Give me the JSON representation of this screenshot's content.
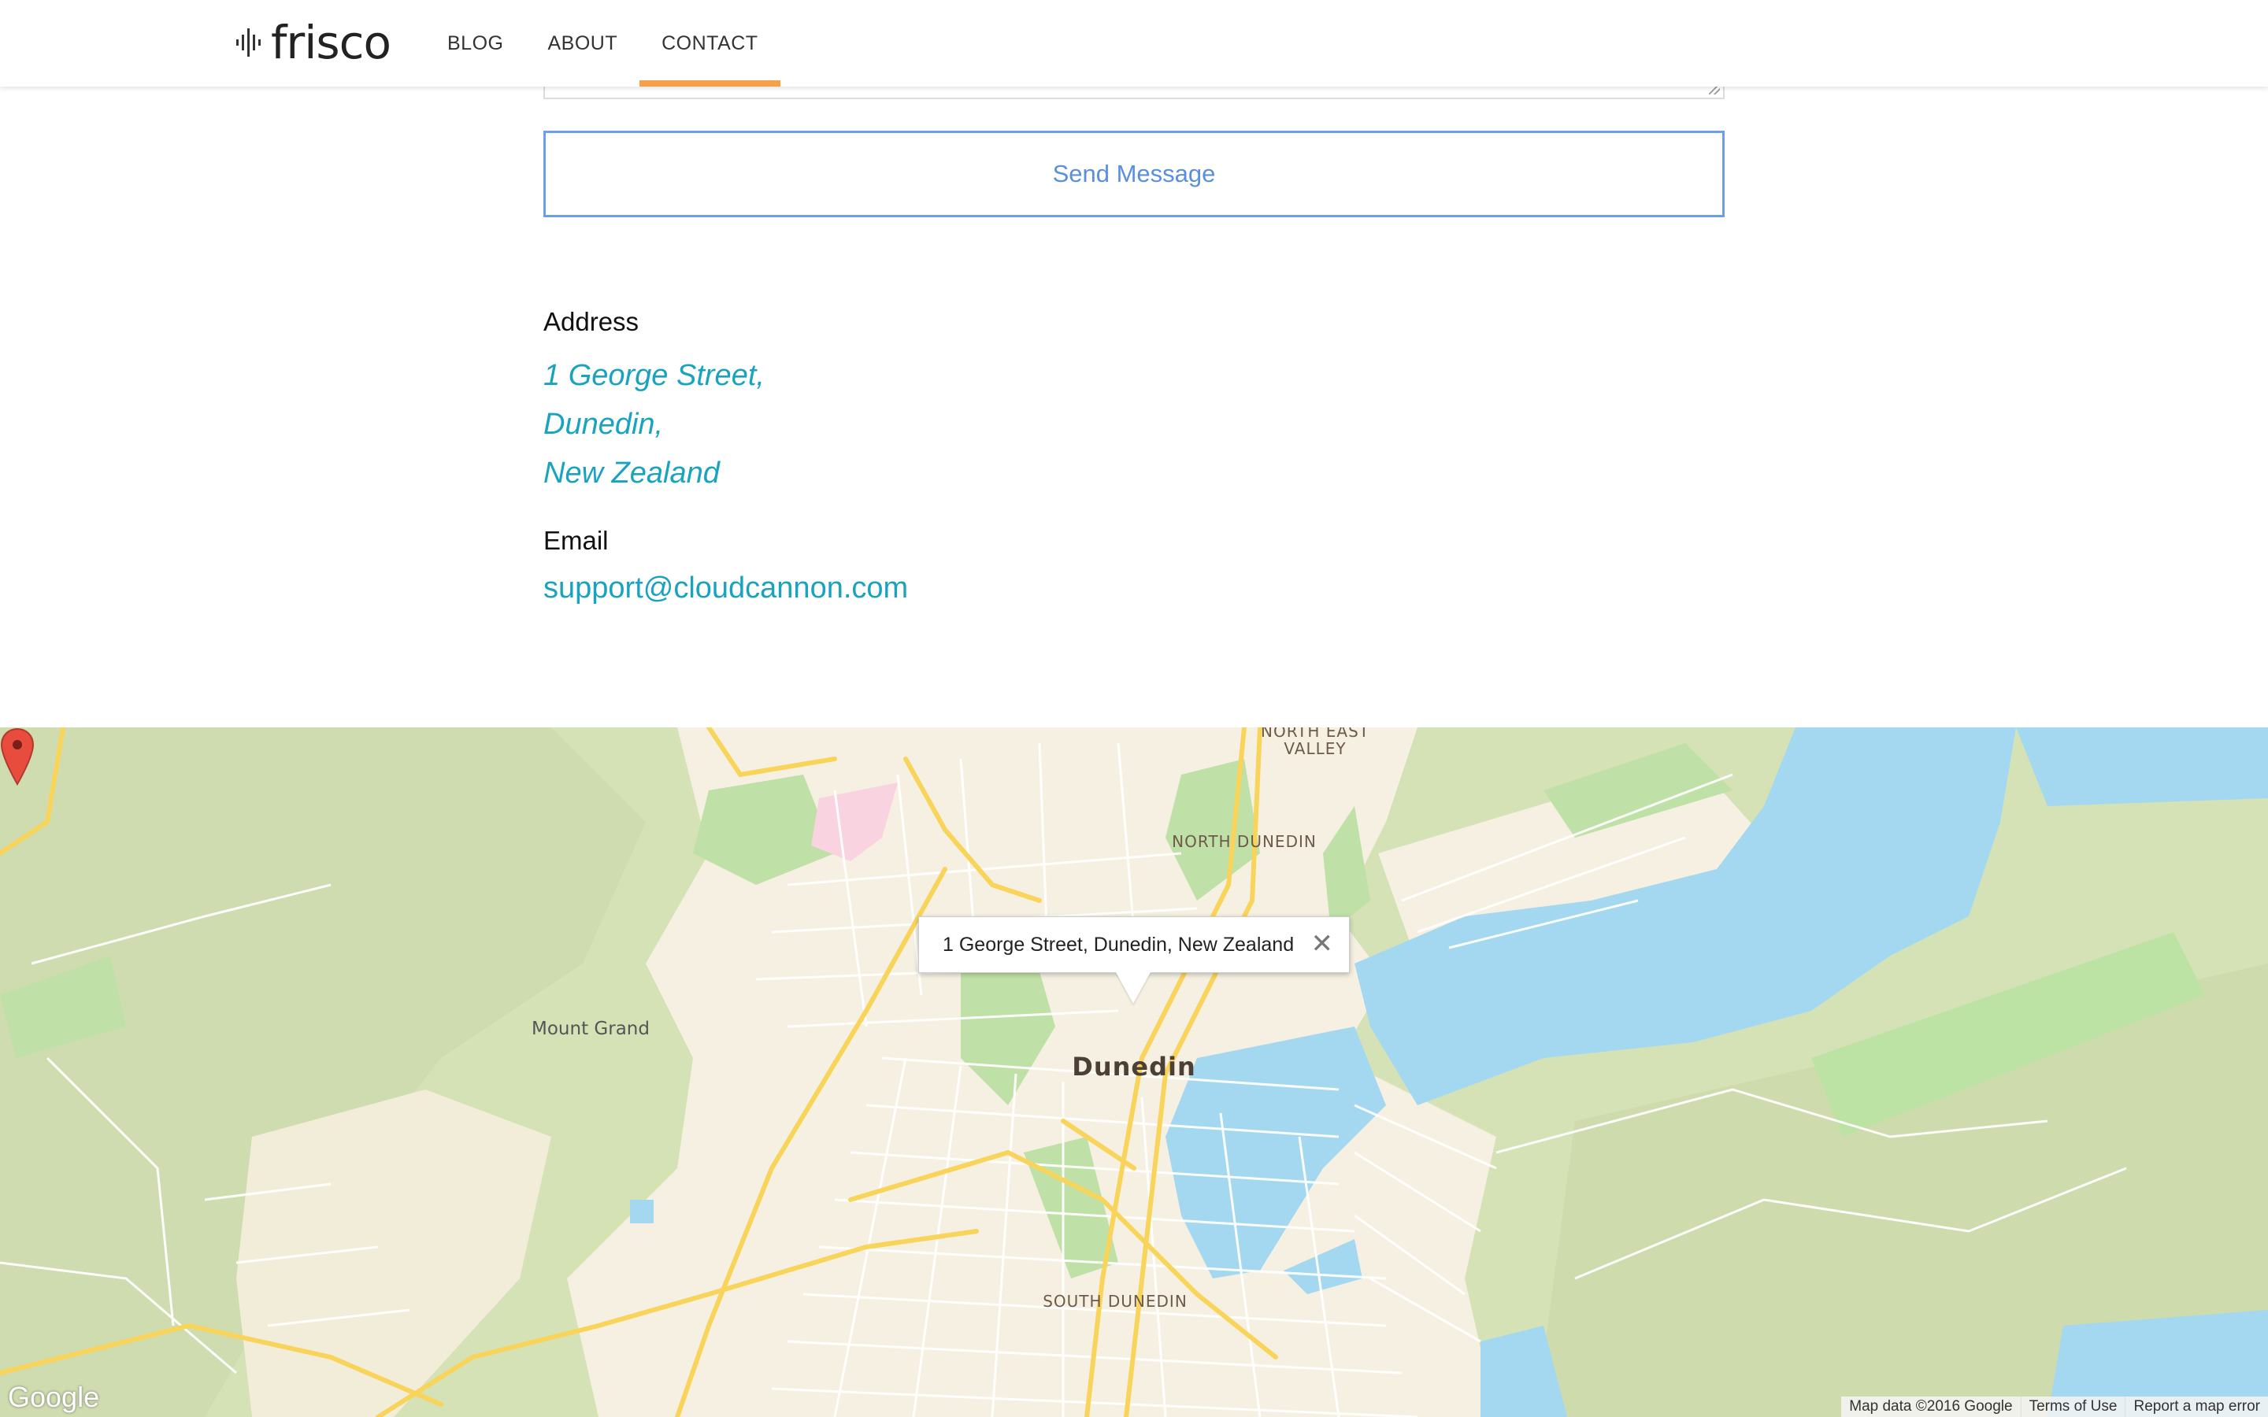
{
  "header": {
    "logo_text": "frisco",
    "logo_icon": "waveform-icon",
    "nav": [
      {
        "label": "BLOG",
        "active": false
      },
      {
        "label": "ABOUT",
        "active": false
      },
      {
        "label": "CONTACT",
        "active": true
      }
    ],
    "active_color": "#f5a04a"
  },
  "form": {
    "send_label": "Send Message",
    "button_color": "#6a9fea"
  },
  "contact": {
    "address_heading": "Address",
    "address_lines": [
      "1 George Street,",
      "Dunedin,",
      "New Zealand"
    ],
    "email_heading": "Email",
    "email": "support@cloudcannon.com",
    "link_color": "#19a3bf"
  },
  "map": {
    "info_window_text": "1 George Street, Dunedin, New Zealand",
    "close_symbol": "✕",
    "labels": {
      "north_east_valley": "NORTH EAST VALLEY",
      "north_dunedin": "NORTH DUNEDIN",
      "mount_grand": "Mount Grand",
      "dunedin": "Dunedin",
      "south_dunedin": "SOUTH DUNEDIN"
    },
    "google_logo": "Google",
    "footer": {
      "map_data": "Map data ©2016 Google",
      "terms": "Terms of Use",
      "report": "Report a map error"
    },
    "colors": {
      "water": "#a4d8f1",
      "land": "#d4e2b6",
      "urban": "#f5f0e1",
      "park": "#bfe0a6",
      "road_major": "#f9d45a",
      "road_minor": "#ffffff",
      "pin": "#e74c3c"
    }
  }
}
